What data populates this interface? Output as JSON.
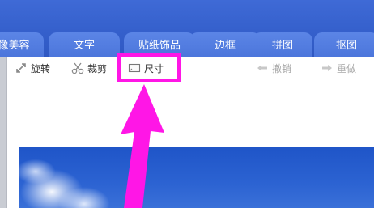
{
  "tabs": [
    {
      "label": "像美容"
    },
    {
      "label": "文字"
    },
    {
      "label": "贴纸饰品"
    },
    {
      "label": "边框"
    },
    {
      "label": "拼图"
    },
    {
      "label": "抠图"
    }
  ],
  "toolbar": {
    "rotate_label": "旋转",
    "crop_label": "裁剪",
    "size_label": "尺寸",
    "undo_label": "撤销",
    "redo_label": "重做"
  },
  "icons": {
    "rotate": "rotate-icon",
    "crop": "scissors-icon",
    "size": "resize-icon",
    "undo": "arrow-left-icon",
    "redo": "arrow-right-icon"
  },
  "colors": {
    "tabbar": "#3560cc",
    "tab": "#4a74da",
    "highlight": "#ff16e6",
    "disabled_text": "#a8a8a8"
  }
}
